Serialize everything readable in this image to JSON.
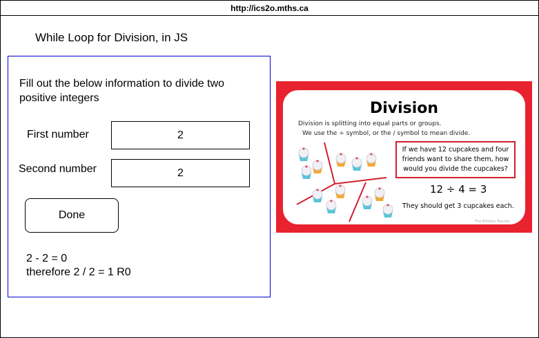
{
  "browser": {
    "url": "http://ics2o.mths.ca"
  },
  "page": {
    "heading": "While Loop for Division, in JS"
  },
  "form": {
    "instructions": "Fill out the below information to divide two positive integers",
    "first_label": "First number",
    "first_value": "2",
    "second_label": "Second number",
    "second_value": "2",
    "done_label": "Done"
  },
  "result": {
    "line1": "2 - 2 = 0",
    "line2": "therefore 2 / 2 = 1 R0"
  },
  "illustration": {
    "title": "Division",
    "line1": "Division is splitting into equal parts or groups.",
    "line2": "We use the ÷ symbol, or the / symbol to mean divide.",
    "question": "If we have 12 cupcakes and four friends want to share them, how would you divide the cupcakes?",
    "equation": "12 ÷ 4 = 3",
    "answer": "They should get 3 cupcakes each.",
    "credit": "The Primary Teacher",
    "border_color": "#e8232f"
  }
}
